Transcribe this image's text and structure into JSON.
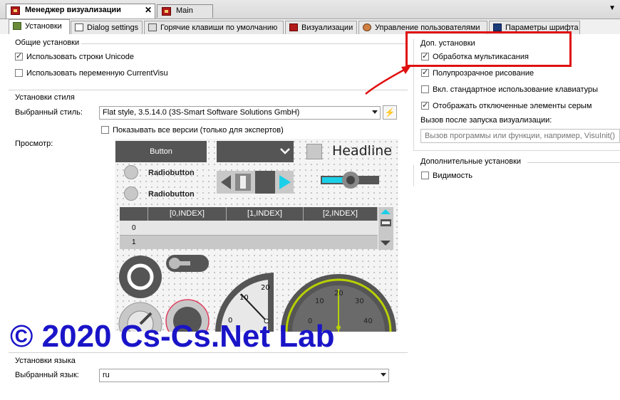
{
  "doc_tabs": [
    {
      "label": "Менеджер визуализации",
      "active": true,
      "closable": true
    },
    {
      "label": "Main",
      "active": false
    }
  ],
  "page_tabs": [
    {
      "label": "Установки",
      "icon": "wrench-icon",
      "active": true
    },
    {
      "label": "Dialog settings",
      "icon": "dialog-icon"
    },
    {
      "label": "Горячие клавиши по умолчанию",
      "icon": "keyboard-icon"
    },
    {
      "label": "Визуализации",
      "icon": "visualization-icon"
    },
    {
      "label": "Управление пользователями",
      "icon": "users-icon"
    },
    {
      "label": "Параметры шрифта",
      "icon": "font-icon"
    }
  ],
  "general": {
    "title": "Общие установки",
    "unicode": {
      "label": "Использовать строки Unicode",
      "checked": true
    },
    "currentvisu": {
      "label": "Использовать переменную CurrentVisu",
      "checked": false
    }
  },
  "style": {
    "title": "Установки стиля",
    "selected_label": "Выбранный стиль:",
    "selected_value": "Flat style, 3.5.14.0 (3S-Smart Software Solutions GmbH)",
    "show_all": {
      "label": "Показывать все версии (только для экспертов)",
      "checked": false
    },
    "preview_label": "Просмотр:"
  },
  "preview": {
    "button": "Button",
    "headline": "Headline",
    "radio1": "Radiobutton",
    "radio2": "Radiobutton",
    "table_headers": [
      "[0,INDEX]",
      "[1,INDEX]",
      "[2,INDEX]"
    ],
    "table_rows": [
      "0",
      "1"
    ],
    "gauge1_ticks": [
      "0",
      "10",
      "20"
    ],
    "gauge2_ticks": [
      "0",
      "10",
      "20",
      "30",
      "40"
    ]
  },
  "extra": {
    "title": "Доп. установки",
    "multitouch": {
      "label": "Обработка мультикасания",
      "checked": true
    },
    "semitransparent": {
      "label": "Полупрозрачное рисование",
      "checked": true
    },
    "keyboard": {
      "label": "Вкл. стандартное использование клавиатуры",
      "checked": false
    },
    "disabled_gray": {
      "label": "Отображать отключенные элементы серым",
      "checked": true
    },
    "after_start_label": "Вызов после запуска визуализации:",
    "after_start_placeholder": "Вызов программы или функции, например, VisuInit();"
  },
  "additional": {
    "title": "Дополнительные установки",
    "visibility": {
      "label": "Видимость",
      "checked": false
    }
  },
  "language": {
    "title": "Установки языка",
    "selected_label": "Выбранный язык:",
    "selected_value": "ru"
  },
  "watermark": "© 2020 Cs-Cs.Net Lab",
  "colors": {
    "annotation_red": "#e01010",
    "watermark_blue": "#1a14c8",
    "accent_cyan": "#1ad0e8",
    "gauge_green": "#b8d000"
  }
}
